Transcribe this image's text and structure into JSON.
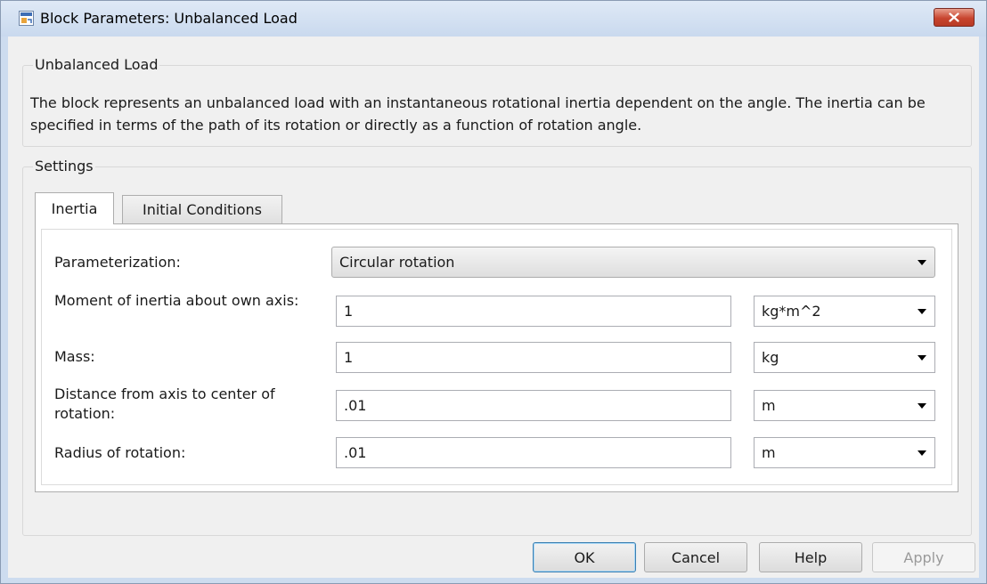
{
  "window": {
    "title": "Block Parameters: Unbalanced Load",
    "close_label": "✕"
  },
  "description_group": {
    "title": "Unbalanced Load",
    "text": "The block represents an unbalanced load with an instantaneous rotational inertia dependent on the angle. The inertia can be specified in terms of the path of its rotation or directly as a function of rotation angle."
  },
  "settings": {
    "title": "Settings",
    "tabs": [
      {
        "label": "Inertia",
        "active": true
      },
      {
        "label": "Initial Conditions",
        "active": false
      }
    ],
    "rows": [
      {
        "label": "Parameterization:",
        "selected": "Circular rotation"
      },
      {
        "label": "Moment of inertia about own axis:",
        "value": "1",
        "unit": "kg*m^2"
      },
      {
        "label": "Mass:",
        "value": "1",
        "unit": "kg"
      },
      {
        "label": "Distance from axis to center of rotation:",
        "value": ".01",
        "unit": "m"
      },
      {
        "label": "Radius of rotation:",
        "value": ".01",
        "unit": "m"
      }
    ]
  },
  "buttons": {
    "ok": "OK",
    "cancel": "Cancel",
    "help": "Help",
    "apply": "Apply"
  },
  "colors": {
    "titlebar": "#cddcef",
    "client": "#f0f0f0",
    "close": "#c8452f",
    "default_button_border": "#3c7fb1"
  },
  "icons": {
    "app": "simulink-block-icon",
    "close": "close-icon",
    "dropdown": "chevron-down-icon"
  }
}
